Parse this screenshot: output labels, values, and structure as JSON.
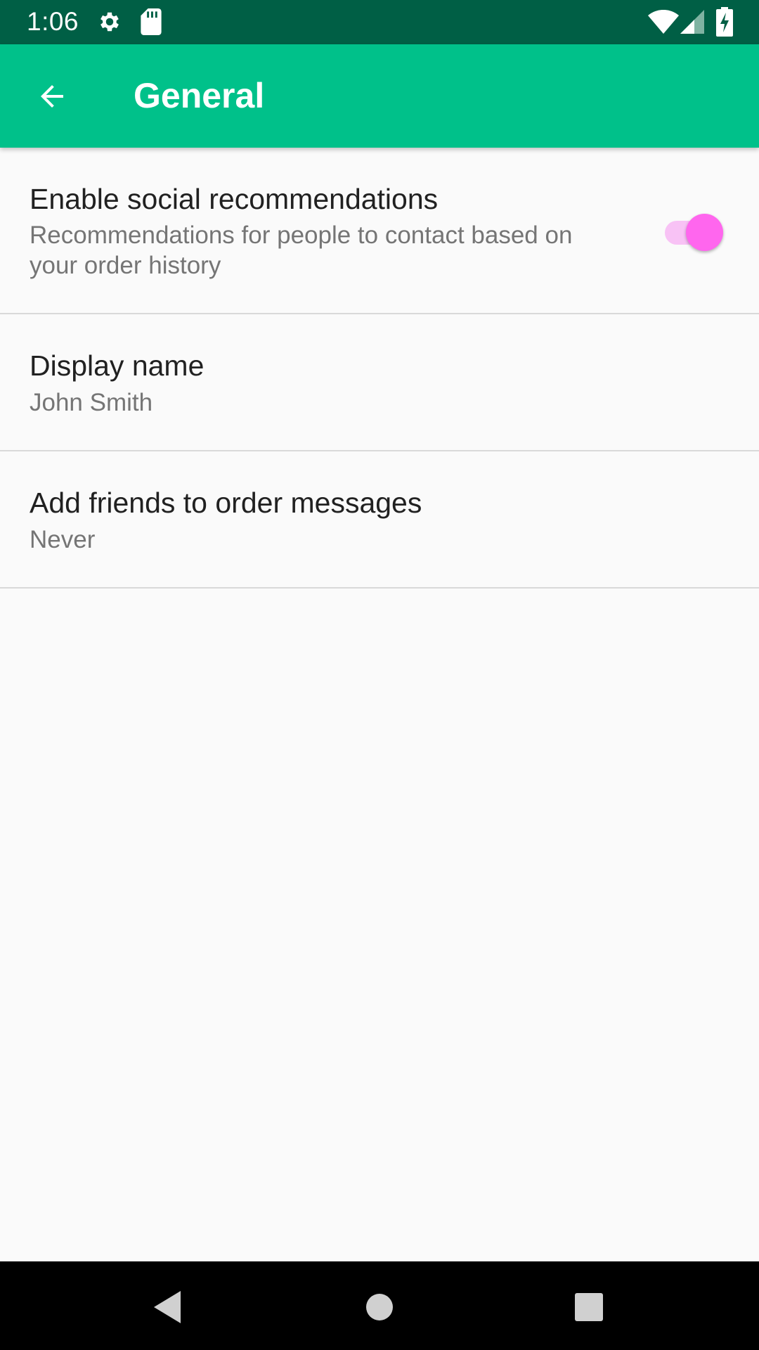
{
  "status_bar": {
    "time": "1:06",
    "icons": [
      "gear-icon",
      "sd-card-icon",
      "wifi-icon",
      "signal-icon",
      "battery-charging-icon"
    ],
    "background": "#005f45"
  },
  "app_bar": {
    "title": "General",
    "back_icon": "arrow-left-icon",
    "background": "#00c18a"
  },
  "preferences": [
    {
      "title": "Enable social recommendations",
      "summary": "Recommendations for people to contact based on your order history",
      "switch_on": true
    },
    {
      "title": "Display name",
      "summary": "John Smith"
    },
    {
      "title": "Add friends to order messages",
      "summary": "Never"
    }
  ],
  "switch_colors": {
    "track": "#f8c2f5",
    "thumb": "#ff66ee"
  },
  "nav_bar": {
    "icons": [
      "nav-back-icon",
      "nav-home-icon",
      "nav-recents-icon"
    ]
  }
}
